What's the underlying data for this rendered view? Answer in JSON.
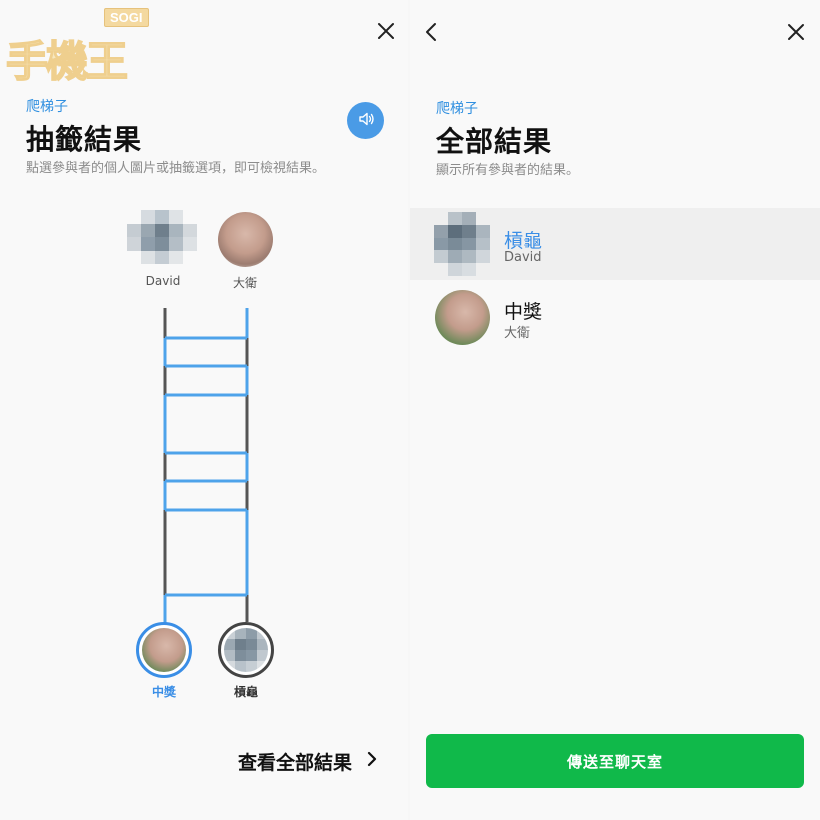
{
  "watermark": {
    "badge": "SOGI",
    "text": "手機王"
  },
  "left": {
    "subtitle": "爬梯子",
    "title": "抽籤結果",
    "description": "點選參與者的個人圖片或抽籤選項，即可檢視結果。",
    "participants": [
      {
        "name": "David"
      },
      {
        "name": "大衛"
      }
    ],
    "results": [
      {
        "label": "中獎",
        "color": "#3a8ee6"
      },
      {
        "label": "槓龜",
        "color": "#333333"
      }
    ],
    "view_all_label": "查看全部結果"
  },
  "right": {
    "subtitle": "爬梯子",
    "title": "全部結果",
    "description": "顯示所有參與者的結果。",
    "rows": [
      {
        "result": "槓龜",
        "name": "David"
      },
      {
        "result": "中獎",
        "name": "大衛"
      }
    ],
    "send_button": "傳送至聊天室"
  },
  "colors": {
    "accent": "#2f8fe0",
    "ladder_blue": "#4ea3ea",
    "ladder_gray": "#555555",
    "send_green": "#10b94a"
  },
  "icons": [
    "close-icon",
    "back-icon",
    "speaker-icon",
    "chevron-right-icon"
  ]
}
